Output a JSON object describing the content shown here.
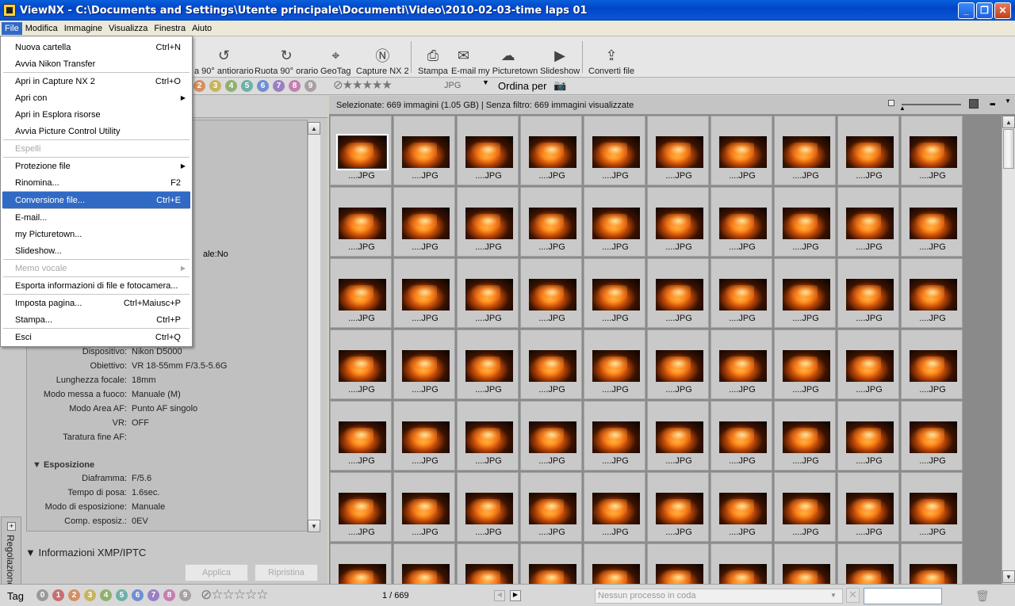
{
  "window": {
    "title": "ViewNX - C:\\Documents and Settings\\Utente principale\\Documenti\\Video\\2010-02-03-time laps 01"
  },
  "menubar": [
    "File",
    "Modifica",
    "Immagine",
    "Visualizza",
    "Finestra",
    "Aiuto"
  ],
  "file_menu": [
    {
      "label": "Nuova cartella",
      "shortcut": "Ctrl+N"
    },
    {
      "label": "Avvia Nikon Transfer",
      "shortcut": ""
    },
    {
      "label": "Apri in Capture NX 2",
      "shortcut": "Ctrl+O"
    },
    {
      "label": "Apri con",
      "shortcut": "",
      "submenu": true
    },
    {
      "label": "Apri in Esplora risorse",
      "shortcut": ""
    },
    {
      "label": "Avvia Picture Control Utility",
      "shortcut": ""
    },
    {
      "label": "Espelli",
      "shortcut": "",
      "disabled": true
    },
    {
      "label": "Protezione file",
      "shortcut": "",
      "submenu": true
    },
    {
      "label": "Rinomina...",
      "shortcut": "F2"
    },
    {
      "label": "Conversione file...",
      "shortcut": "Ctrl+E",
      "highlighted": true
    },
    {
      "label": "E-mail...",
      "shortcut": ""
    },
    {
      "label": "my Picturetown...",
      "shortcut": ""
    },
    {
      "label": "Slideshow...",
      "shortcut": ""
    },
    {
      "label": "Memo vocale",
      "shortcut": "",
      "disabled": true,
      "submenu": true
    },
    {
      "label": "Esporta informazioni di file e fotocamera...",
      "shortcut": ""
    },
    {
      "label": "Imposta pagina...",
      "shortcut": "Ctrl+Maiusc+P"
    },
    {
      "label": "Stampa...",
      "shortcut": "Ctrl+P"
    },
    {
      "label": "Esci",
      "shortcut": "Ctrl+Q"
    }
  ],
  "toolbar": {
    "rotate_left": "a 90° antiorario",
    "rotate_right": "Ruota 90° orario",
    "geotag": "GeoTag",
    "capture_nx": "Capture NX 2",
    "print": "Stampa",
    "email": "E-mail",
    "picturetown": "my Picturetown",
    "slideshow": "Slideshow",
    "convert": "Converti file"
  },
  "filterbar": {
    "labels": [
      "2",
      "3",
      "4",
      "5",
      "6",
      "7",
      "8",
      "9"
    ],
    "format": "JPG",
    "sort": "Ordina per"
  },
  "left_panel": {
    "partial_text": "ale:No",
    "rows": [
      {
        "k": "Dispositivo:",
        "v": "Nikon D5000"
      },
      {
        "k": "Obiettivo:",
        "v": "VR 18-55mm F/3.5-5.6G"
      },
      {
        "k": "Lunghezza focale:",
        "v": "18mm"
      },
      {
        "k": "Modo messa a fuoco:",
        "v": "Manuale (M)"
      },
      {
        "k": "Modo Area AF:",
        "v": "Punto AF singolo"
      },
      {
        "k": "VR:",
        "v": "OFF"
      },
      {
        "k": "Taratura fine AF:",
        "v": ""
      }
    ],
    "esposizione_title": "Esposizione",
    "esposizione": [
      {
        "k": "Diaframma:",
        "v": "F/5.6"
      },
      {
        "k": "Tempo di posa:",
        "v": "1.6sec."
      },
      {
        "k": "Modo di esposizione:",
        "v": "Manuale"
      },
      {
        "k": "Comp. esposiz.:",
        "v": "0EV"
      }
    ],
    "xmp_title": "Informazioni XMP/IPTC",
    "apply": "Applica",
    "reset": "Ripristina",
    "vertical_tab": "Regolazione rapida"
  },
  "content": {
    "selection_info": "Selezionate: 669 immagini (1.05 GB) | Senza filtro: 669 immagini visualizzate",
    "thumb_label": "....JPG",
    "rows": 7,
    "cols": 10
  },
  "statusbar": {
    "tag": "Tag",
    "labels": [
      "0",
      "1",
      "2",
      "3",
      "4",
      "5",
      "6",
      "7",
      "8",
      "9"
    ],
    "page": "1 / 669",
    "queue": "Nessun processo in coda"
  },
  "colors": {
    "label_dots": [
      "#9a9a9a",
      "#c76f6f",
      "#d29064",
      "#c7b45f",
      "#8fb070",
      "#6fb0a8",
      "#6f8fd0",
      "#9a7fc4",
      "#c47fb0",
      "#a8a0a0"
    ]
  }
}
